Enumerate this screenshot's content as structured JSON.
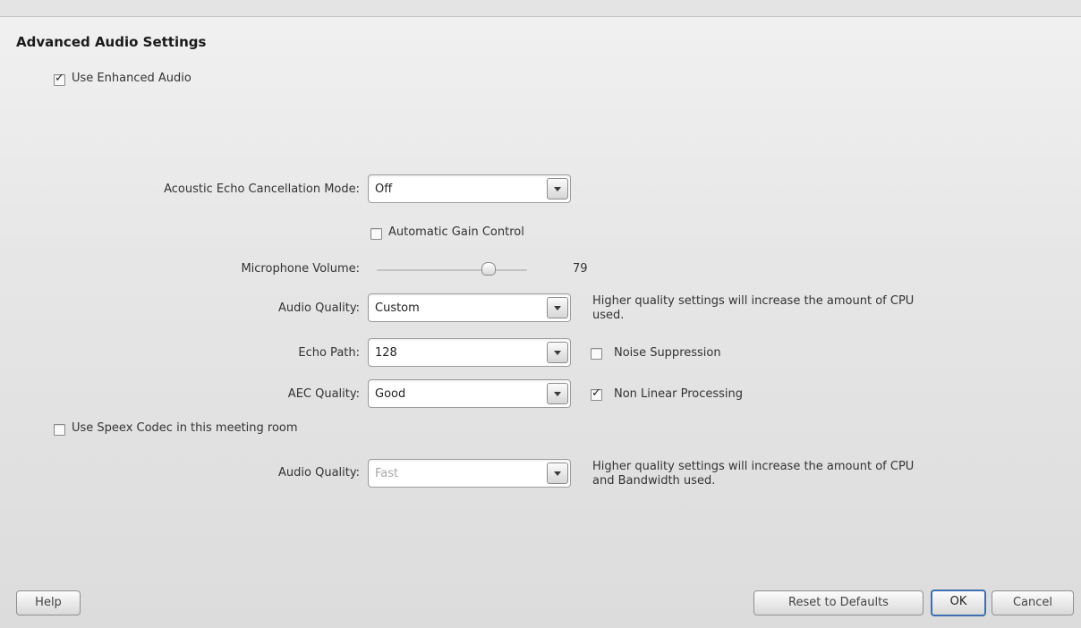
{
  "title": "Advanced Audio Settings",
  "enhanced_audio": {
    "label": "Use Enhanced Audio",
    "checked": true
  },
  "aec_mode": {
    "label": "Acoustic Echo Cancellation Mode:",
    "value": "Off"
  },
  "agc": {
    "label": "Automatic Gain Control",
    "checked": false
  },
  "mic_volume": {
    "label": "Microphone Volume:",
    "value": "79",
    "level": 0.79
  },
  "audio_quality": {
    "label": "Audio Quality:",
    "value": "Custom",
    "help_line1": "Higher quality settings will increase the amount of CPU",
    "help_line2": "used."
  },
  "echo_path": {
    "label": "Echo Path:",
    "value": "128"
  },
  "noise_suppression": {
    "label": "Noise Suppression",
    "checked": false
  },
  "aec_quality": {
    "label": "AEC Quality:",
    "value": "Good"
  },
  "non_linear": {
    "label": "Non Linear Processing",
    "checked": true
  },
  "speex": {
    "label": "Use Speex Codec in this meeting room",
    "checked": false
  },
  "speex_quality": {
    "label": "Audio Quality:",
    "value": "Fast",
    "help_line1": "Higher quality settings will increase the amount of CPU",
    "help_line2": "and Bandwidth used."
  },
  "buttons": {
    "help": "Help",
    "reset": "Reset to Defaults",
    "ok": "OK",
    "cancel": "Cancel"
  }
}
